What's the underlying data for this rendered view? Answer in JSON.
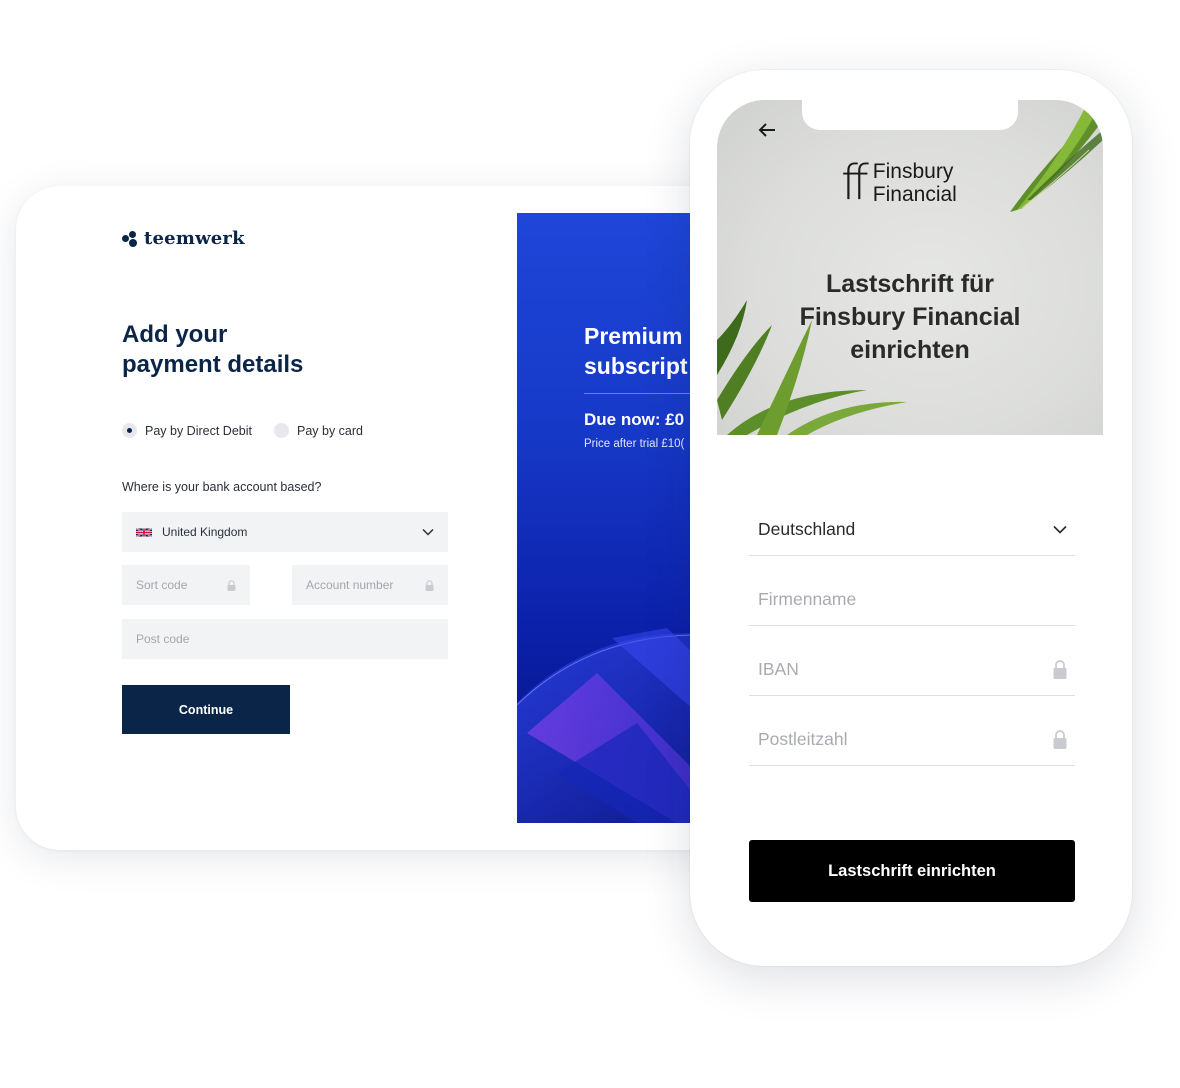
{
  "desktop": {
    "brand": {
      "name": "teemwerk",
      "color": "#0b2548"
    },
    "title_line1": "Add your",
    "title_line2": "payment details",
    "payment_options": [
      {
        "label": "Pay by Direct Debit",
        "selected": true
      },
      {
        "label": "Pay by card",
        "selected": false
      }
    ],
    "bank_question": "Where is your bank account based?",
    "country_select": {
      "value": "United Kingdom",
      "flag": "uk-flag-icon"
    },
    "sort_code_placeholder": "Sort code",
    "account_number_placeholder": "Account number",
    "post_code_placeholder": "Post code",
    "continue_label": "Continue",
    "promo": {
      "title_line1": "Premium",
      "title_line2": "subscript",
      "due_now": "Due now: £0",
      "price_after_trial": "Price after trial £10("
    }
  },
  "mobile": {
    "brand_mark": "ff",
    "brand_line1": "Finsbury",
    "brand_line2": "Financial",
    "title_line1": "Lastschrift für",
    "title_line2": "Finsbury Financial",
    "title_line3": "einrichten",
    "country_value": "Deutschland",
    "company_placeholder": "Firmenname",
    "iban_placeholder": "IBAN",
    "postcode_placeholder": "Postleitzahl",
    "submit_label": "Lastschrift einrichten"
  },
  "colors": {
    "navy": "#0b2548",
    "promo_blue": "#1e46d8",
    "field_bg": "#f2f3f5",
    "mobile_button": "#000000"
  }
}
